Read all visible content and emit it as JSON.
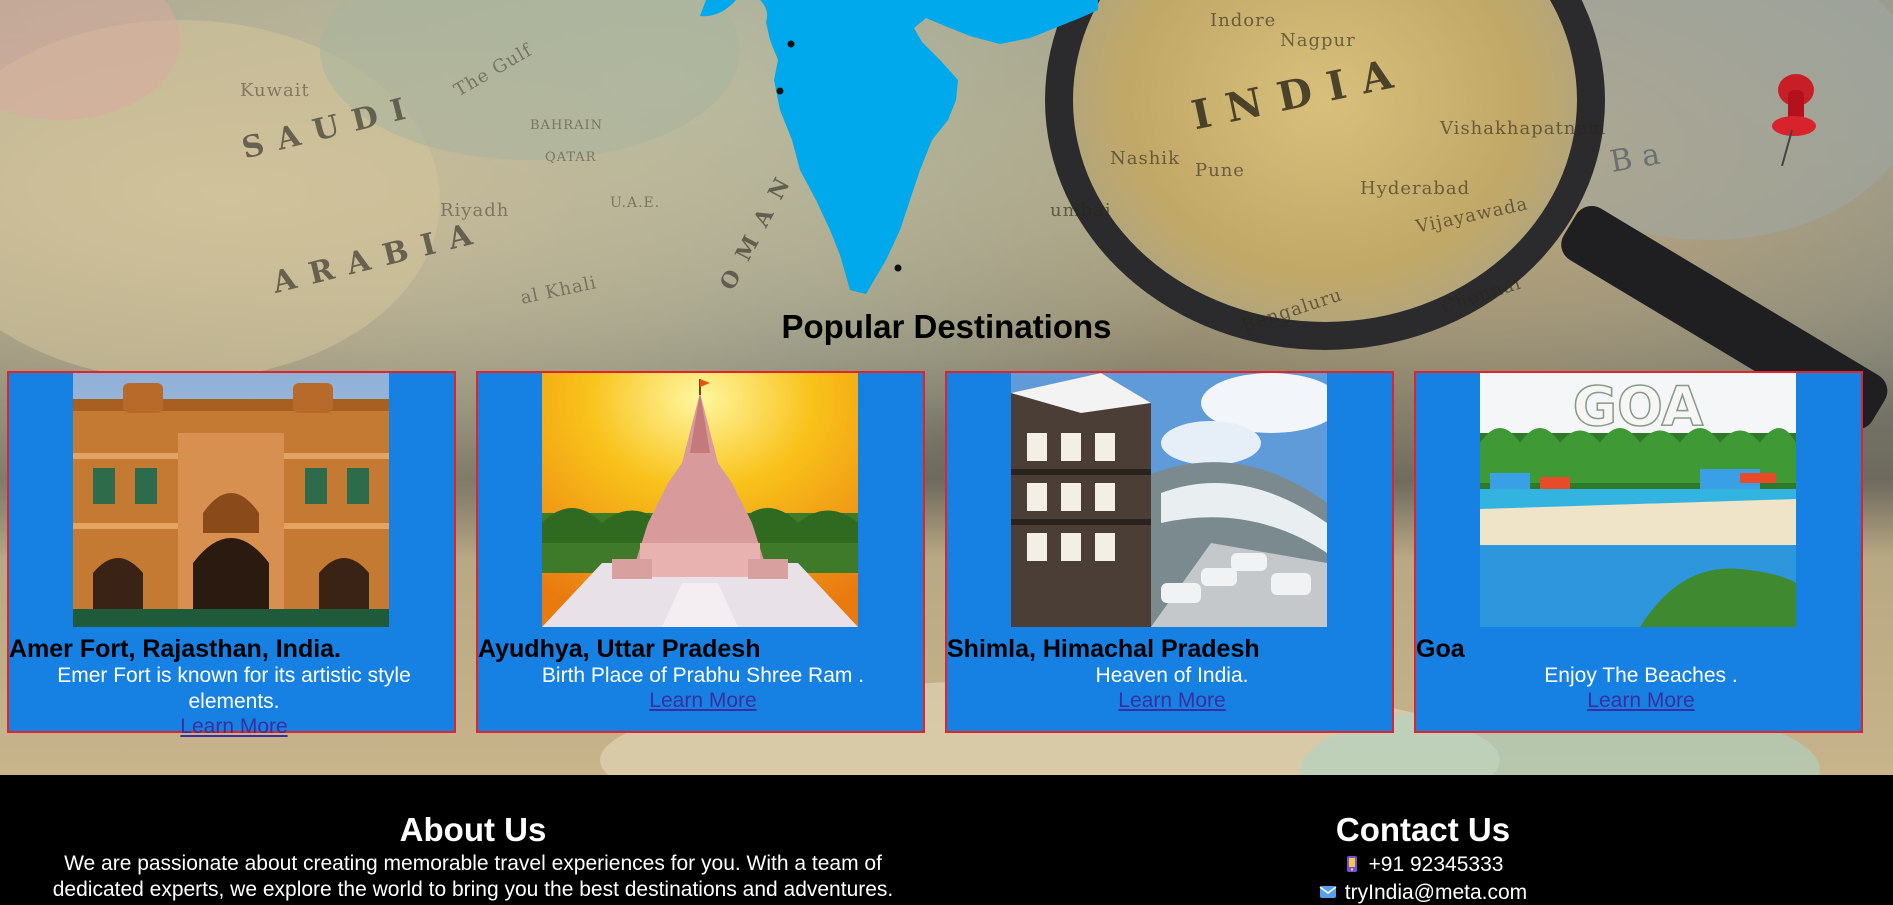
{
  "hero": {
    "map_labels": {
      "saudi": "SAUDI",
      "arabia": "ARABIA",
      "india": "INDIA",
      "oman": "OMAN",
      "the_gulf": "The Gulf",
      "riyadh": "Riyadh",
      "kuwait": "Kuwait",
      "pune": "Pune",
      "hyderabad": "Hyderabad",
      "nagpur": "Nagpur",
      "indore": "Indore",
      "vijayawada": "Vijayawada",
      "bengaluru": "Bengaluru",
      "nashik": "Nashik",
      "chennai": "Chennai",
      "mumbai": "umbai",
      "visakhapatnam": "Vishakhapatnam",
      "qatar": "QATAR",
      "bahrain": "BAHRAIN",
      "uae": "U.A.E.",
      "empty_quarter": "al Khali",
      "bay": "Ba"
    }
  },
  "destinations": {
    "title": "Popular Destinations",
    "cards": [
      {
        "name": "Amer Fort, Rajasthan, India.",
        "description": "Emer Fort is known for its artistic style elements.",
        "link": "Learn More",
        "image": "amer-fort-photo"
      },
      {
        "name": "Ayudhya, Uttar Pradesh",
        "description": "Birth Place of Prabhu Shree Ram .",
        "link": "Learn More",
        "image": "ram-mandir-photo"
      },
      {
        "name": "Shimla, Himachal Pradesh",
        "description": "Heaven of India.",
        "link": "Learn More",
        "image": "shimla-photo"
      },
      {
        "name": "Goa",
        "description": "Enjoy The Beaches .",
        "link": "Learn More",
        "image": "goa-photo",
        "image_text": "GOA"
      }
    ]
  },
  "footer": {
    "about": {
      "title": "About Us",
      "text": "We are passionate about creating memorable travel experiences for you. With a team of dedicated experts, we explore the world to bring you the best destinations and adventures."
    },
    "contact": {
      "title": "Contact Us",
      "phone": "+91 92345333",
      "email": "tryIndia@meta.com",
      "phone_icon": "phone-icon",
      "email_icon": "email-icon"
    }
  },
  "colors": {
    "card_bg": "#1681e2",
    "card_border": "#e0242a",
    "india_map": "#00a8ec",
    "footer_bg": "#000000",
    "link": "#3a2fa0"
  }
}
